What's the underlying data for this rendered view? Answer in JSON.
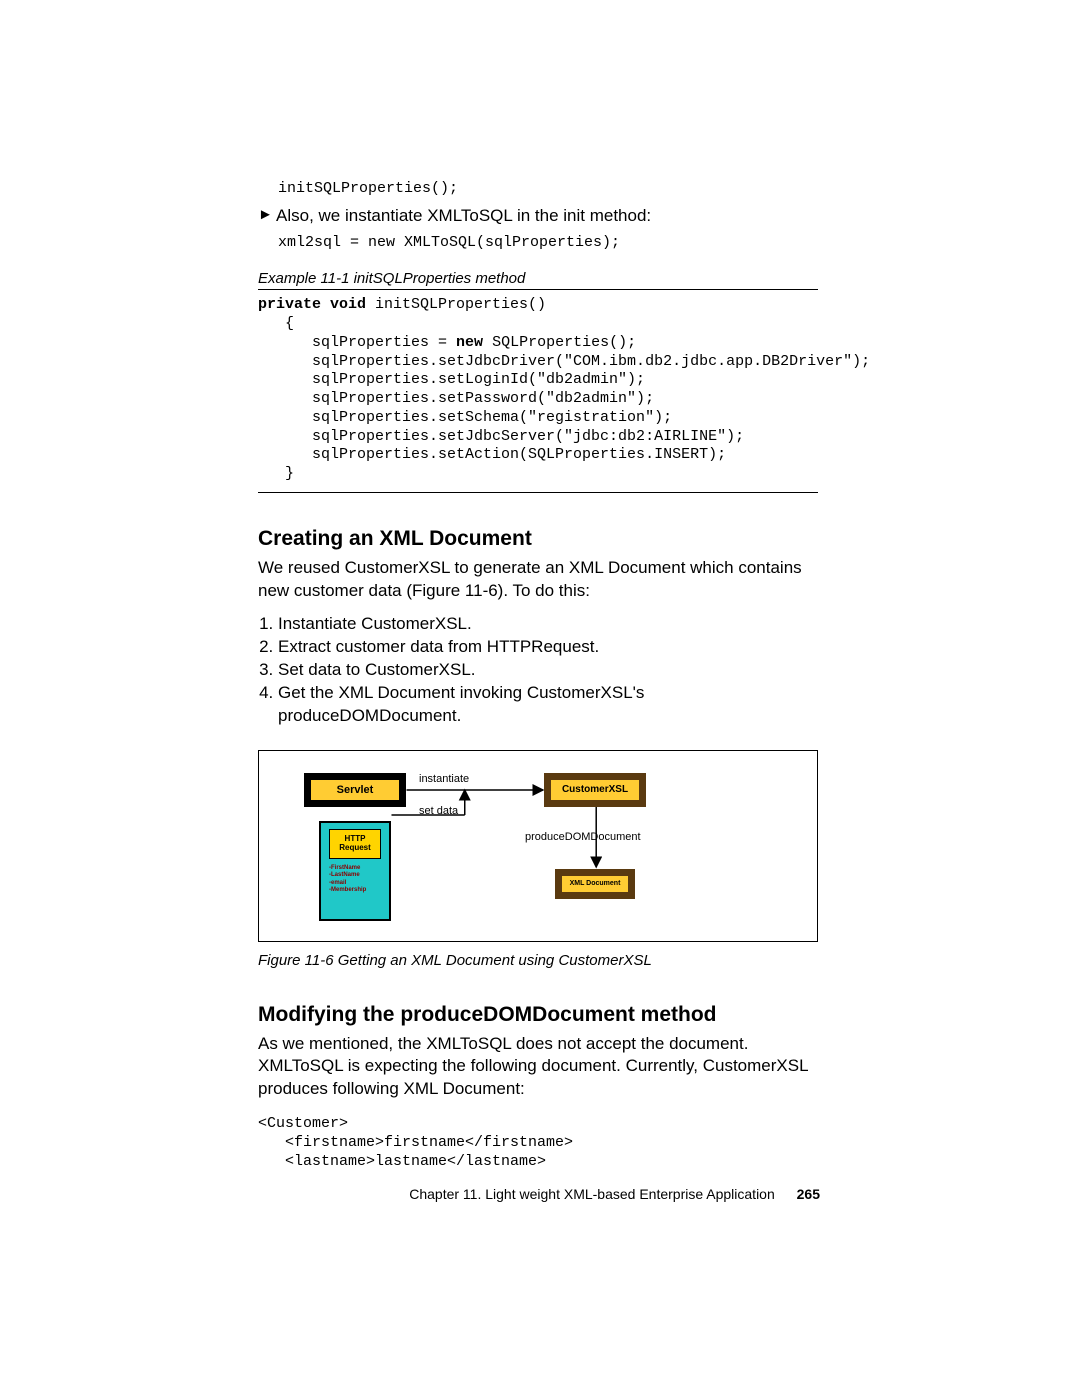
{
  "code1": "initSQLProperties();",
  "bullet1_marker": "►",
  "bullet1_text": "Also, we instantiate XMLToSQL in the init method:",
  "code2": "xml2sql = new XMLToSQL(sqlProperties);",
  "example_caption": "Example 11-1   initSQLProperties method",
  "example_code": "private void initSQLProperties()\n   {\n      sqlProperties = new SQLProperties();\n      sqlProperties.setJdbcDriver(\"COM.ibm.db2.jdbc.app.DB2Driver\");\n      sqlProperties.setLoginId(\"db2admin\");\n      sqlProperties.setPassword(\"db2admin\");\n      sqlProperties.setSchema(\"registration\");\n      sqlProperties.setJdbcServer(\"jdbc:db2:AIRLINE\");\n      sqlProperties.setAction(SQLProperties.INSERT);\n   }",
  "example_code_bold_prefix": "private void",
  "example_code_bold_inline": "new",
  "section1_title": "Creating an XML Document",
  "section1_para": "We reused CustomerXSL to generate an XML Document which contains new customer data (Figure 11-6). To do this:",
  "steps": [
    "Instantiate CustomerXSL.",
    "Extract customer data from HTTPRequest.",
    "Set data to CustomerXSL.",
    "Get the XML Document invoking CustomerXSL's produceDOMDocument."
  ],
  "diagram": {
    "servlet": "Servlet",
    "customerxsl": "CustomerXSL",
    "xml_doc": "XML Document",
    "http_request": "HTTP\nRequest",
    "http_fields": "-FirstName\n-LastName\n-email\n-Membership",
    "lbl_instantiate": "instantiate",
    "lbl_setdata": "set data",
    "lbl_produce": "produceDOMDocument"
  },
  "figure_caption": "Figure 11-6   Getting an XML Document using CustomerXSL",
  "section2_title": "Modifying the produceDOMDocument method",
  "section2_para": "As we mentioned, the XMLToSQL does not accept the document. XMLToSQL is expecting the following document. Currently, CustomerXSL produces following XML Document:",
  "code3": "<Customer>\n   <firstname>firstname</firstname>\n   <lastname>lastname</lastname>",
  "footer_chapter": "Chapter 11. Light weight XML-based Enterprise Application",
  "footer_page": "265"
}
